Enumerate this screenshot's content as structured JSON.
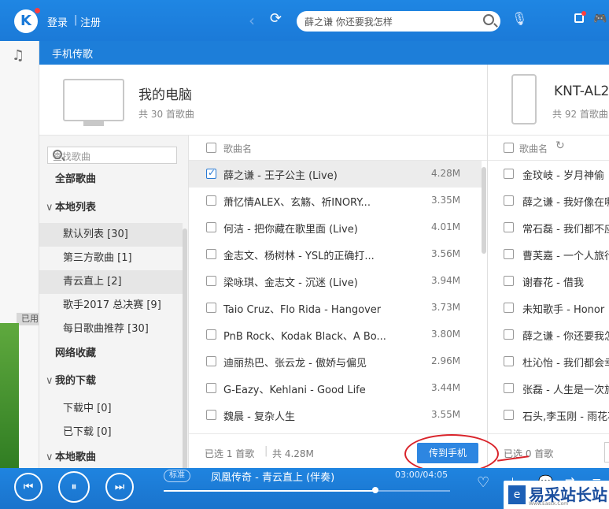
{
  "app": {
    "logo": "K",
    "login": "登录",
    "divider": "|",
    "register": "注册",
    "back_arrow": "‹",
    "refresh": "⟳",
    "search_value": "薛之谦 你还要我怎样",
    "mic": "🎙",
    "game": "🎮"
  },
  "left_strip": {
    "badge": "已用"
  },
  "transfer": {
    "title": "手机传歌"
  },
  "pc": {
    "name": "我的电脑",
    "count": "共 30 首歌曲"
  },
  "phone": {
    "name": "KNT-AL2",
    "count": "共 92 首歌曲"
  },
  "sidebar": {
    "search_placeholder": "查找歌曲",
    "all": "全部歌曲",
    "local_list": "本地列表",
    "local_items": [
      "默认列表 [30]",
      "第三方歌曲 [1]",
      "青云直上 [2]",
      "歌手2017 总决赛 [9]",
      "每日歌曲推荐 [30]"
    ],
    "network": "网络收藏",
    "my_download": "我的下载",
    "download_items": [
      "下载中 [0]",
      "已下载 [0]"
    ],
    "local_songs": "本地歌曲"
  },
  "pc_list": {
    "header": "歌曲名",
    "rows": [
      {
        "name": "薛之谦 - 王子公主 (Live)",
        "size": "4.28M",
        "checked": true
      },
      {
        "name": "萧忆情ALEX、玄觞、祈INORY...",
        "size": "3.35M",
        "checked": false
      },
      {
        "name": "何洁 - 把你藏在歌里面 (Live)",
        "size": "4.01M",
        "checked": false
      },
      {
        "name": "金志文、杨树林 - YSL的正确打...",
        "size": "3.56M",
        "checked": false
      },
      {
        "name": "梁咏琪、金志文 - 沉迷 (Live)",
        "size": "3.94M",
        "checked": false
      },
      {
        "name": "Taio Cruz、Flo Rida - Hangover",
        "size": "3.73M",
        "checked": false
      },
      {
        "name": "PnB Rock、Kodak Black、A Bo...",
        "size": "3.80M",
        "checked": false
      },
      {
        "name": "迪丽热巴、张云龙 - 傲娇与偏见",
        "size": "2.96M",
        "checked": false
      },
      {
        "name": "G-Eazy、Kehlani - Good Life",
        "size": "3.44M",
        "checked": false
      },
      {
        "name": "魏晨 - 复杂人生",
        "size": "3.55M",
        "checked": false
      }
    ],
    "footer_selected": "已选 1 首歌",
    "footer_sep": "|",
    "footer_total": "共 4.28M",
    "transfer_button": "传到手机"
  },
  "phone_list": {
    "header": "歌曲名",
    "refresh": "↻",
    "rows": [
      "金玟岐 - 岁月神偷",
      "薛之谦 - 我好像在哪",
      "常石磊 - 我们都不应",
      "曹芙嘉 - 一个人旅行",
      "谢春花 - 借我",
      "未知歌手 - Honor",
      "薛之谦 - 你还要我怎",
      "杜沁怡 - 我们都会幸",
      "张磊 - 人生是一次旅",
      "石头,李玉刚 - 雨花石"
    ],
    "footer_selected": "已选 0 首歌"
  },
  "player": {
    "prev": "⏮",
    "pause": "⏸",
    "next": "⏭",
    "quality": "标准",
    "song": "凤凰传奇 - 青云直上 (伴奏)",
    "time": "03:00/04:05",
    "progress": 0.74,
    "heart": "♡",
    "download": "⤓",
    "comment": "💬",
    "mode": "⇄",
    "more": "≡"
  },
  "watermark": {
    "badge": "e",
    "text": "易采站长站",
    "sub": "Www.Easck.Com"
  }
}
